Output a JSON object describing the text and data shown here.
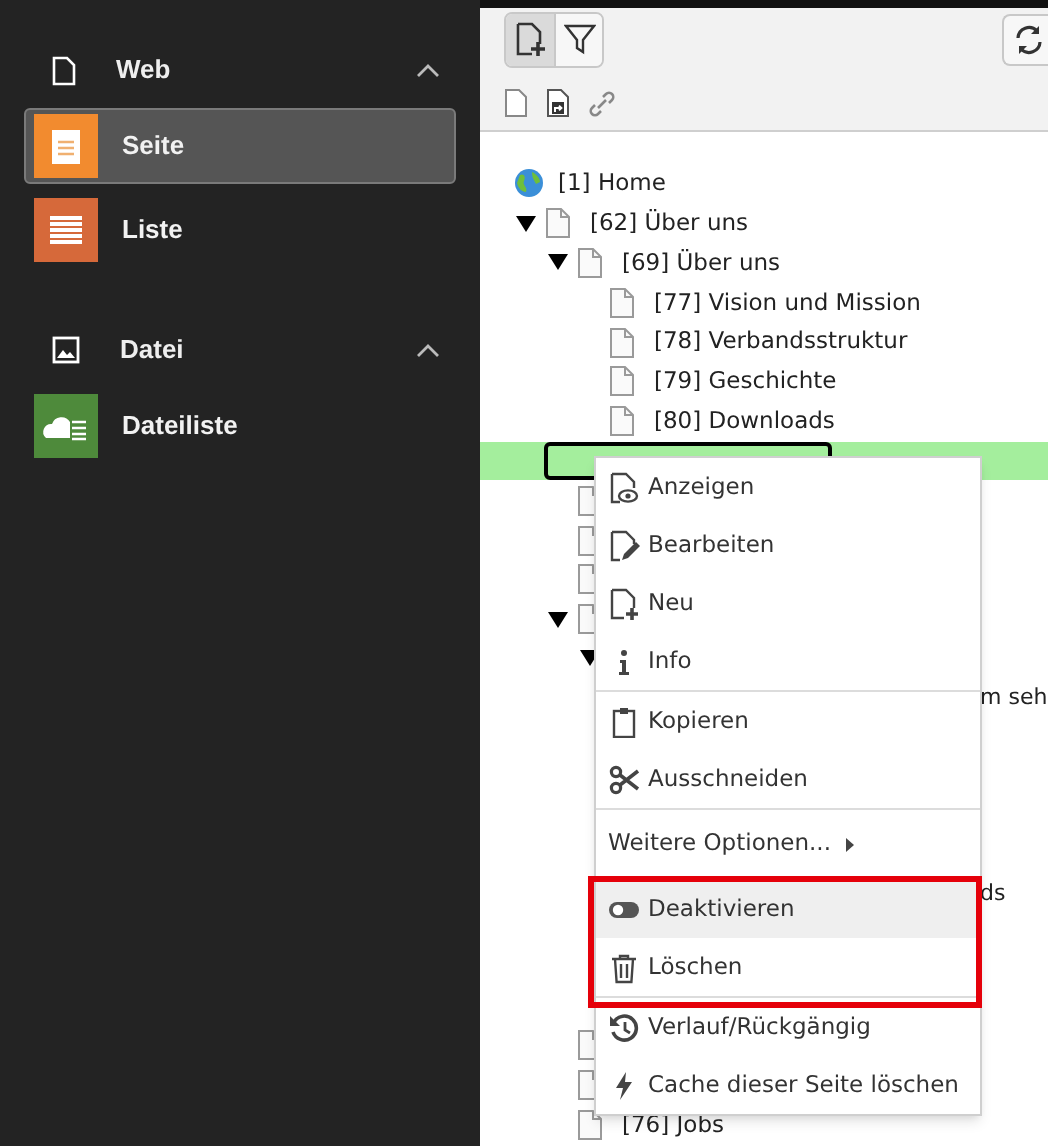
{
  "sidebar": {
    "groups": [
      {
        "label": "Web",
        "kind": "page",
        "expanded": true,
        "items": [
          {
            "label": "Seite",
            "kind": "page",
            "color": "#f28b2f",
            "selected": true
          },
          {
            "label": "Liste",
            "kind": "list",
            "color": "#d6693a",
            "selected": false
          }
        ]
      },
      {
        "label": "Datei",
        "kind": "image",
        "expanded": true,
        "items": [
          {
            "label": "Dateiliste",
            "kind": "filelist",
            "color": "#4e8a3b",
            "selected": false
          }
        ]
      }
    ]
  },
  "toolbar": {
    "buttons": [
      {
        "kind": "new-page",
        "selected": true
      },
      {
        "kind": "filter",
        "selected": false
      }
    ],
    "actions": [
      {
        "kind": "page"
      },
      {
        "kind": "page-link"
      },
      {
        "kind": "link"
      }
    ]
  },
  "tree": [
    {
      "label": "[1] Home",
      "kind": "root",
      "children": [
        {
          "label": "[62] Über uns",
          "kind": "page",
          "expanded": true,
          "children": [
            {
              "label": "[69] Über uns",
              "kind": "page",
              "expanded": true,
              "children": [
                {
                  "label": "[77] Vision und Mission",
                  "kind": "page"
                },
                {
                  "label": "[78] Verbandsstruktur",
                  "kind": "page"
                },
                {
                  "label": "[79] Geschichte",
                  "kind": "page"
                },
                {
                  "label": "[80] Downloads",
                  "kind": "page"
                }
              ]
            },
            {
              "kind": "editing",
              "selected": true
            },
            {
              "kind": "page"
            },
            {
              "kind": "page"
            },
            {
              "kind": "page"
            },
            {
              "kind": "page",
              "expanded": true,
              "children": [
                {
                  "kind": "hidden",
                  "expanded": true,
                  "children": [
                    {
                      "label": "m seh",
                      "kind": "fragment"
                    },
                    {
                      "label": "ds",
                      "kind": "fragment"
                    }
                  ]
                }
              ]
            },
            {
              "kind": "page"
            },
            {
              "kind": "page"
            },
            {
              "label": "[76] Jobs",
              "kind": "page"
            }
          ]
        }
      ]
    }
  ],
  "context_menu": {
    "groups": [
      [
        {
          "label": "Anzeigen",
          "kind": "view",
          "selected": false
        },
        {
          "label": "Bearbeiten",
          "kind": "edit",
          "selected": false
        },
        {
          "label": "Neu",
          "kind": "new",
          "selected": false
        },
        {
          "label": "Info",
          "kind": "info",
          "selected": false
        }
      ],
      [
        {
          "label": "Kopieren",
          "kind": "copy",
          "selected": false
        },
        {
          "label": "Ausschneiden",
          "kind": "cut",
          "selected": false
        }
      ],
      [
        {
          "label": "Weitere Optionen...",
          "kind": "submenu",
          "selected": false
        }
      ],
      [
        {
          "label": "Deaktivieren",
          "kind": "toggle",
          "selected": true
        },
        {
          "label": "Löschen",
          "kind": "delete",
          "selected": false
        }
      ],
      [
        {
          "label": "Verlauf/Rückgängig",
          "kind": "history",
          "selected": false
        },
        {
          "label": "Cache dieser Seite löschen",
          "kind": "flash",
          "selected": false
        }
      ]
    ]
  }
}
